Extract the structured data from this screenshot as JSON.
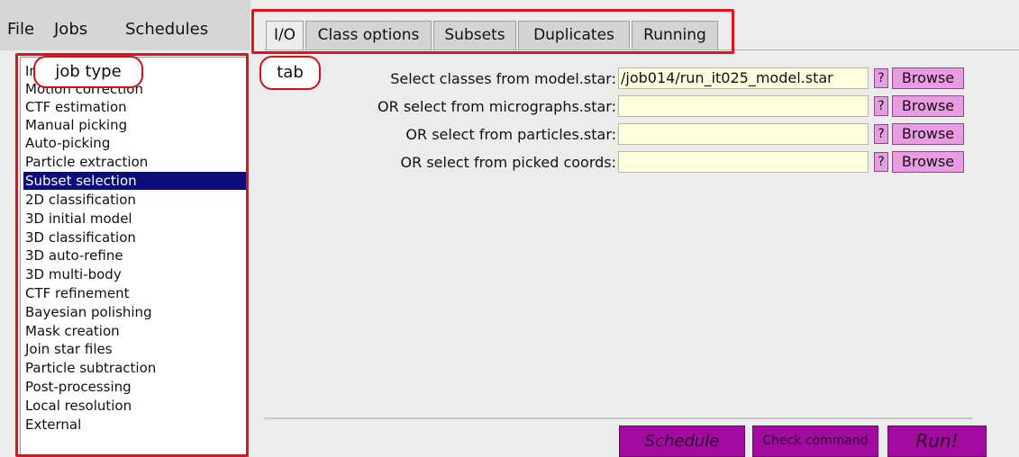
{
  "menu": {
    "file": "File",
    "jobs": "Jobs",
    "schedules": "Schedules"
  },
  "job_types": [
    "Import",
    "Motion correction",
    "CTF estimation",
    "Manual picking",
    "Auto-picking",
    "Particle extraction",
    "Subset selection",
    "2D classification",
    "3D initial model",
    "3D classification",
    "3D auto-refine",
    "3D multi-body",
    "CTF refinement",
    "Bayesian polishing",
    "Mask creation",
    "Join star files",
    "Particle subtraction",
    "Post-processing",
    "Local resolution",
    "External"
  ],
  "selected_job": "Subset selection",
  "tabs": [
    "I/O",
    "Class options",
    "Subsets",
    "Duplicates",
    "Running"
  ],
  "active_tab": "I/O",
  "form": {
    "rows": [
      {
        "label": "Select classes from model.star:",
        "value": "/job014/run_it025_model.star",
        "help": "?",
        "browse": "Browse"
      },
      {
        "label": "OR select from micrographs.star:",
        "value": "",
        "help": "?",
        "browse": "Browse"
      },
      {
        "label": "OR select from particles.star:",
        "value": "",
        "help": "?",
        "browse": "Browse"
      },
      {
        "label": "OR select from picked coords:",
        "value": "",
        "help": "?",
        "browse": "Browse"
      }
    ]
  },
  "buttons": {
    "schedule": "Schedule",
    "check": "Check command",
    "run": "Run!"
  },
  "annotations": {
    "job_type": "job type",
    "tab": "tab"
  },
  "colors": {
    "selection": "#0b0b7a",
    "field_bg": "#ffffe0",
    "action_button": "#a30aa0",
    "annotation_red": "#e0121b"
  }
}
